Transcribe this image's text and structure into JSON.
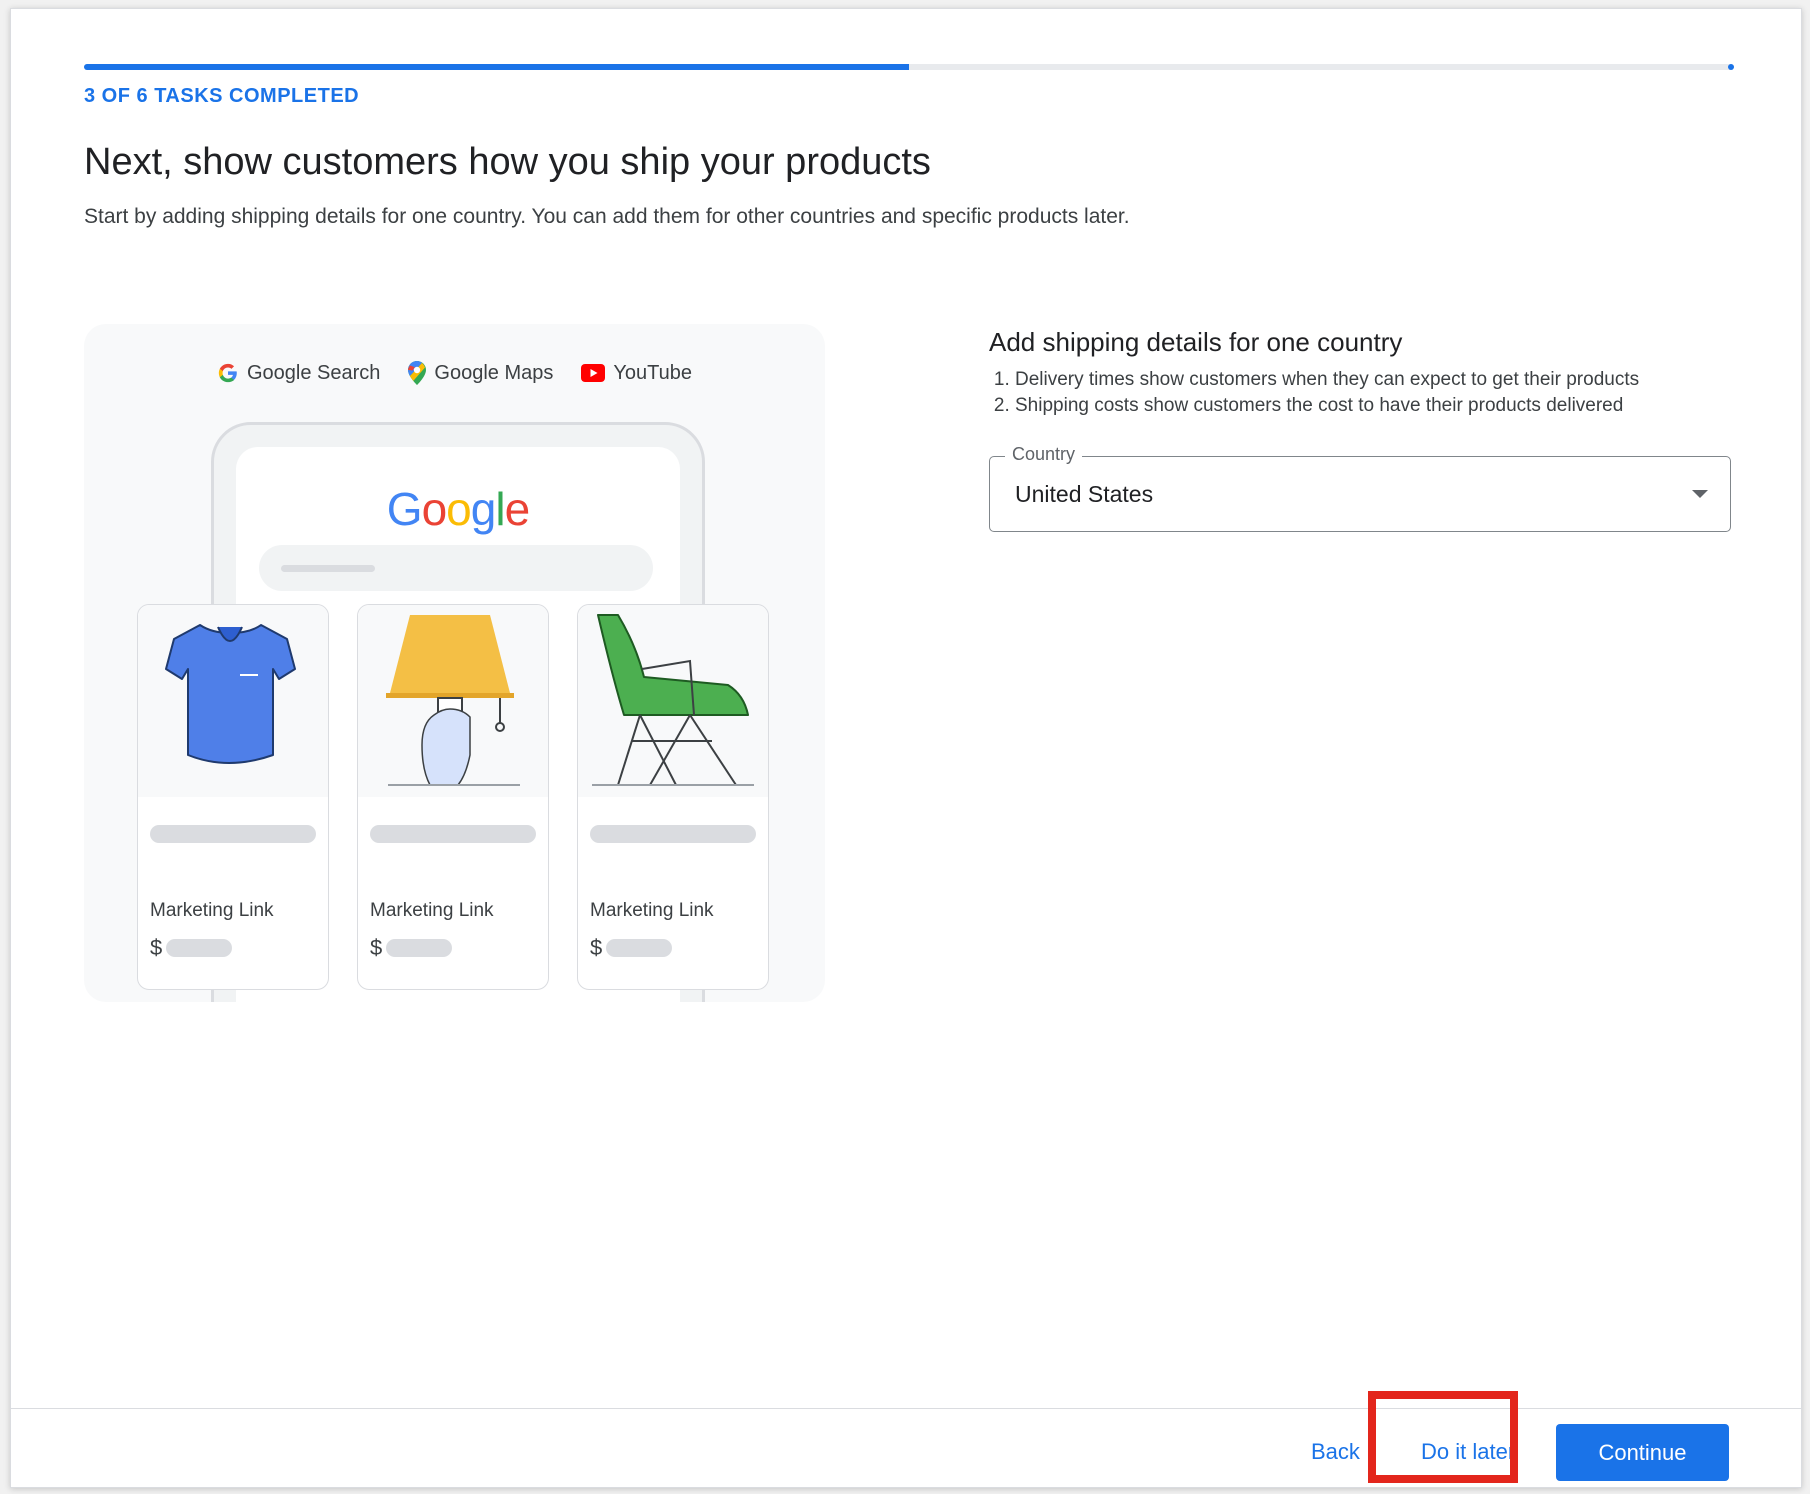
{
  "progress": {
    "label": "3 OF 6 TASKS COMPLETED",
    "completed": 3,
    "total": 6,
    "fraction": 0.5,
    "color": "#1a73e8"
  },
  "header": {
    "title": "Next, show customers how you ship your products",
    "subtitle": "Start by adding shipping details for one country. You can add them for other countries and specific products later."
  },
  "illustration": {
    "surfaces": [
      {
        "label": "Google Search",
        "icon": "google-g-icon"
      },
      {
        "label": "Google Maps",
        "icon": "map-pin-icon"
      },
      {
        "label": "YouTube",
        "icon": "youtube-icon"
      }
    ],
    "logo_text": "Google",
    "cards": [
      {
        "label": "Marketing Link",
        "price_symbol": "$",
        "image": "shirt-icon"
      },
      {
        "label": "Marketing Link",
        "price_symbol": "$",
        "image": "lamp-icon"
      },
      {
        "label": "Marketing Link",
        "price_symbol": "$",
        "image": "chair-icon"
      }
    ]
  },
  "shipping": {
    "title": "Add shipping details for one country",
    "steps": [
      "Delivery times show customers when they can expect to get their products",
      "Shipping costs show customers the cost to have their products delivered"
    ],
    "country_label": "Country",
    "country_value": "United States"
  },
  "footer": {
    "back_label": "Back",
    "later_label": "Do it later",
    "continue_label": "Continue",
    "highlight_color": "#e3261c"
  }
}
